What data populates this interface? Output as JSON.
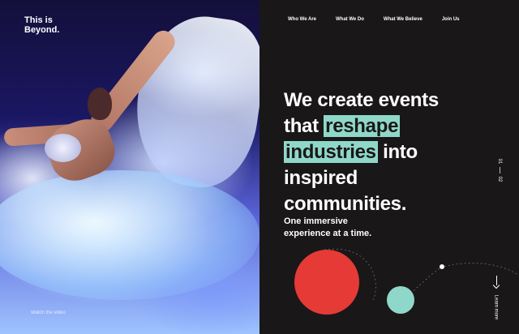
{
  "brand": {
    "logo_line1": "This is",
    "logo_line2": "Beyond."
  },
  "hero": {
    "watch_label": "Watch the video"
  },
  "nav": {
    "items": [
      "Who We Are",
      "What We Do",
      "What We Believe",
      "Join Us"
    ]
  },
  "headline": {
    "part1": "We create events that",
    "highlight1": "reshape",
    "highlight2": "industries",
    "part2": "into inspired communities."
  },
  "subheadline": {
    "line1": "One immersive",
    "line2": "experience at a time."
  },
  "pager": {
    "current": "01",
    "total": "02"
  },
  "cta": {
    "learn_more": "Learn more"
  },
  "colors": {
    "accent_teal": "#8fd8c9",
    "accent_red": "#e63a36",
    "background": "#1a1718"
  },
  "icons": {
    "learn_more": "arrow-down-icon"
  }
}
